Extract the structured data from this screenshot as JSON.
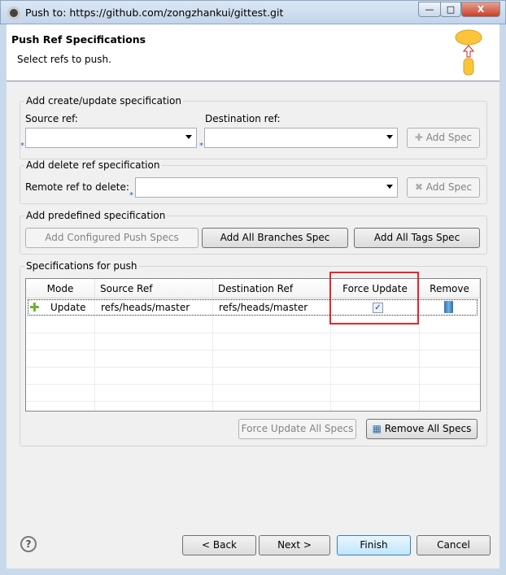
{
  "window": {
    "title": "Push to: https://github.com/zongzhankui/gittest.git",
    "minimize": "—",
    "maximize": "□",
    "close": "X"
  },
  "header": {
    "title": "Push Ref Specifications",
    "subtitle": "Select refs to push."
  },
  "create": {
    "label": "Add create/update specification",
    "source_label": "Source ref:",
    "source_value": "",
    "dest_label": "Destination ref:",
    "dest_value": "",
    "add_label": "Add Spec"
  },
  "delete": {
    "label": "Add delete ref specification",
    "remote_label": "Remote ref to delete:",
    "remote_value": "",
    "add_label": "Add Spec"
  },
  "predefined": {
    "label": "Add predefined specification",
    "configured": "Add Configured Push Specs",
    "branches": "Add All Branches Spec",
    "tags": "Add All Tags Spec"
  },
  "specs": {
    "label": "Specifications for push",
    "columns": [
      "Mode",
      "Source Ref",
      "Destination Ref",
      "Force Update",
      "Remove"
    ],
    "rows": [
      {
        "mode": "Update",
        "source": "refs/heads/master",
        "dest": "refs/heads/master",
        "force": true
      }
    ],
    "force_all": "Force Update All Specs",
    "remove_all": "Remove All Specs"
  },
  "footer": {
    "back": "< Back",
    "next": "Next >",
    "finish": "Finish",
    "cancel": "Cancel",
    "help": "?"
  },
  "colors": {
    "highlight": "#e8262b",
    "accent": "#3c7fb1"
  }
}
